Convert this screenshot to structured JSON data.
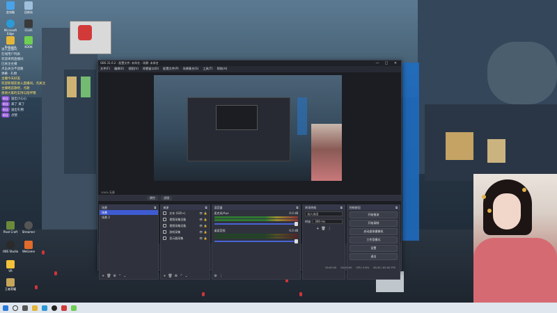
{
  "desktop": {
    "icons": [
      {
        "label": "此电脑"
      },
      {
        "label": "回收站"
      },
      {
        "label": "Microsoft Edge"
      },
      {
        "label": "Clash"
      },
      {
        "label": "KeAnimi"
      },
      {
        "label": "KOOK"
      },
      {
        "label": "Pixel Craft"
      },
      {
        "label": "Streamer"
      },
      {
        "label": "OBS Studio"
      },
      {
        "label": "WeGame"
      },
      {
        "label": "VR"
      },
      {
        "label": "王者荣耀"
      }
    ]
  },
  "chat": {
    "lines": [
      {
        "text": "进入直播间",
        "tag": ""
      },
      {
        "text": "在线用户列表",
        "tag": ""
      },
      {
        "text": "欢迎来到直播间",
        "tag": ""
      },
      {
        "text": "已关注主播",
        "tag": ""
      },
      {
        "text": "点击关注不迷路",
        "tag": ""
      },
      {
        "text": "弹幕 · 礼物",
        "tag": ""
      },
      {
        "text": "主播今天好美",
        "tag": ""
      },
      {
        "text": "欢迎新朋友进入直播间，点关注",
        "tag": ""
      },
      {
        "text": "主播唱首歌吧，点歌",
        "tag": ""
      },
      {
        "text": "感谢大家的支持与陪伴哦",
        "tag": ""
      },
      {
        "text": "送出小心心",
        "tag": "粉丝"
      },
      {
        "text": "来了 来了",
        "tag": "粉丝"
      },
      {
        "text": "送出礼物",
        "tag": "粉丝"
      },
      {
        "text": "点赞",
        "tag": "粉丝"
      }
    ]
  },
  "obs": {
    "title": "OBS 31.0.2 - 配置文件: 未命名 - 场景: 未命名",
    "window_controls": {
      "minimize": "—",
      "maximize": "□",
      "close": "✕"
    },
    "menu": [
      "文件(F)",
      "编辑(E)",
      "视图(V)",
      "停靠窗口(D)",
      "配置文件(P)",
      "场景集合(S)",
      "工具(T)",
      "帮助(H)"
    ],
    "small_label": "100% 无源",
    "scenebar": {
      "properties": "属性",
      "filters": "滤镜"
    },
    "docks": {
      "scenes": {
        "title": "场景",
        "items": [
          {
            "label": "场景",
            "active": true
          },
          {
            "label": "场景 2",
            "active": false
          }
        ],
        "footer": [
          "+",
          "🗑",
          "⚙",
          "⌃",
          "⌄"
        ]
      },
      "sources": {
        "title": "来源",
        "items": [
          {
            "label": "文本 (GDI+)"
          },
          {
            "label": "视频采集设备"
          },
          {
            "label": "视频采集设备"
          },
          {
            "label": "游戏采集"
          },
          {
            "label": "显示器采集"
          }
        ],
        "footer": [
          "+",
          "🗑",
          "⚙",
          "⌃",
          "⌄"
        ]
      },
      "mixer": {
        "title": "混音器",
        "channels": [
          {
            "name": "麦克风/Aux",
            "db": "0.0 dB"
          },
          {
            "name": "桌面音频",
            "db": "0.0 dB"
          }
        ]
      },
      "transitions": {
        "title": "转场特效",
        "selected": "淡入淡出",
        "duration_label": "时长",
        "duration_value": "300 ms"
      },
      "controls": {
        "title": "控制按钮",
        "buttons": [
          "开始推流",
          "开始录制",
          "启动虚拟摄像机",
          "工作室模式",
          "设置",
          "退出"
        ]
      }
    },
    "status": {
      "stream_time": "00:00:00",
      "rec_time": "00:00:00",
      "cpu": "CPU: 0.6%",
      "fps": "60.00 / 60.00 FPS"
    }
  },
  "colors": {
    "accent": "#3e5bd1",
    "obs_bg": "#272a33",
    "dock_bg": "#2f323c",
    "taskbar": "#dfe6ee"
  }
}
